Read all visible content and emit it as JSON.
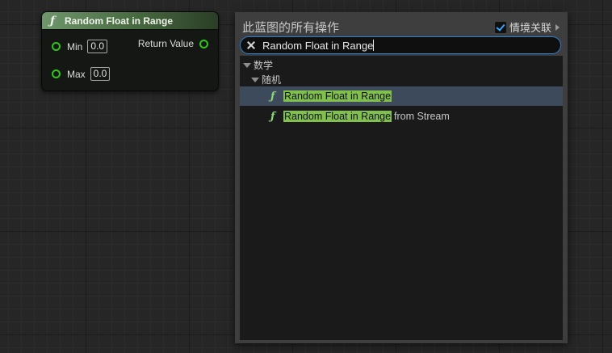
{
  "node": {
    "title": "Random Float in Range",
    "icon": "function-icon",
    "header_color": "#5e8a58",
    "pin_color": "#34c41a",
    "inputs": [
      {
        "label": "Min",
        "value": "0.0"
      },
      {
        "label": "Max",
        "value": "0.0"
      }
    ],
    "output": {
      "label": "Return Value"
    }
  },
  "menu": {
    "title": "此蓝图的所有操作",
    "context_sensitive_label": "情境关联",
    "context_sensitive_checked": true,
    "search": {
      "value": "Random Float in Range",
      "placeholder": ""
    },
    "categories": [
      {
        "label": "数学"
      },
      {
        "label": "随机"
      }
    ],
    "items": [
      {
        "match": "Random Float in Range",
        "rest": "",
        "selected": true
      },
      {
        "match": "Random Float in Range",
        "rest": "from Stream",
        "selected": false
      }
    ],
    "highlight_color": "#82c04e",
    "selection_color": "#3c4a5c",
    "focus_color": "#2f7fd3"
  }
}
